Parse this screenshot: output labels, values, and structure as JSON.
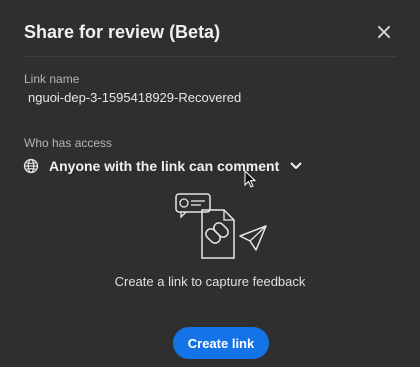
{
  "dialog": {
    "title": "Share for review (Beta)",
    "close_icon": "close-icon"
  },
  "link_name": {
    "label": "Link name",
    "value": "nguoi-dep-3-1595418929-Recovered"
  },
  "access": {
    "label": "Who has access",
    "icon": "globe-icon",
    "selected_option": "Anyone with the link can comment",
    "dropdown_icon": "chevron-down-icon"
  },
  "empty_state": {
    "illustration": "share-link-illustration",
    "message": "Create a link to capture feedback"
  },
  "actions": {
    "create_link_label": "Create link"
  },
  "colors": {
    "background": "#2f2f2f",
    "primary_button": "#1473e6",
    "text": "#f0f0f0",
    "muted_text": "#b4b4b4"
  }
}
